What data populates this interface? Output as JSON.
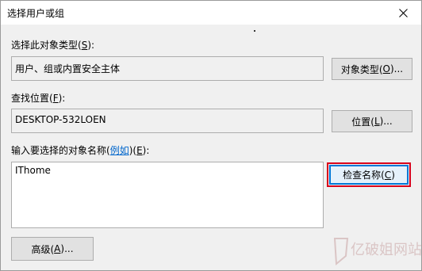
{
  "window": {
    "title": "选择用户或组",
    "close_icon": "close-icon"
  },
  "object_type": {
    "label": "选择此对象类型(",
    "accel": "S",
    "label_suffix": "):",
    "value": "用户、组或内置安全主体",
    "button_label_prefix": "对象类型(",
    "button_accel": "O",
    "button_label_suffix": ")..."
  },
  "location": {
    "label": "查找位置(",
    "accel": "F",
    "label_suffix": "):",
    "value": "DESKTOP-532LOEN",
    "button_label_prefix": "位置(",
    "button_accel": "L",
    "button_label_suffix": ")..."
  },
  "names": {
    "label": "输入要选择的对象名称(",
    "example_link": "例如",
    "label_suffix": ")(",
    "accel": "E",
    "label_end": "):",
    "value": "IThome",
    "check_button_prefix": "检查名称(",
    "check_button_accel": "C",
    "check_button_suffix": ")"
  },
  "advanced": {
    "button_prefix": "高级(",
    "button_accel": "A",
    "button_suffix": ")..."
  },
  "watermark": {
    "text": "亿破姐网站",
    "color": "#c9a3a3"
  },
  "colors": {
    "highlight": "#d9001b",
    "focus": "#0078d7",
    "link": "#0066cc"
  }
}
